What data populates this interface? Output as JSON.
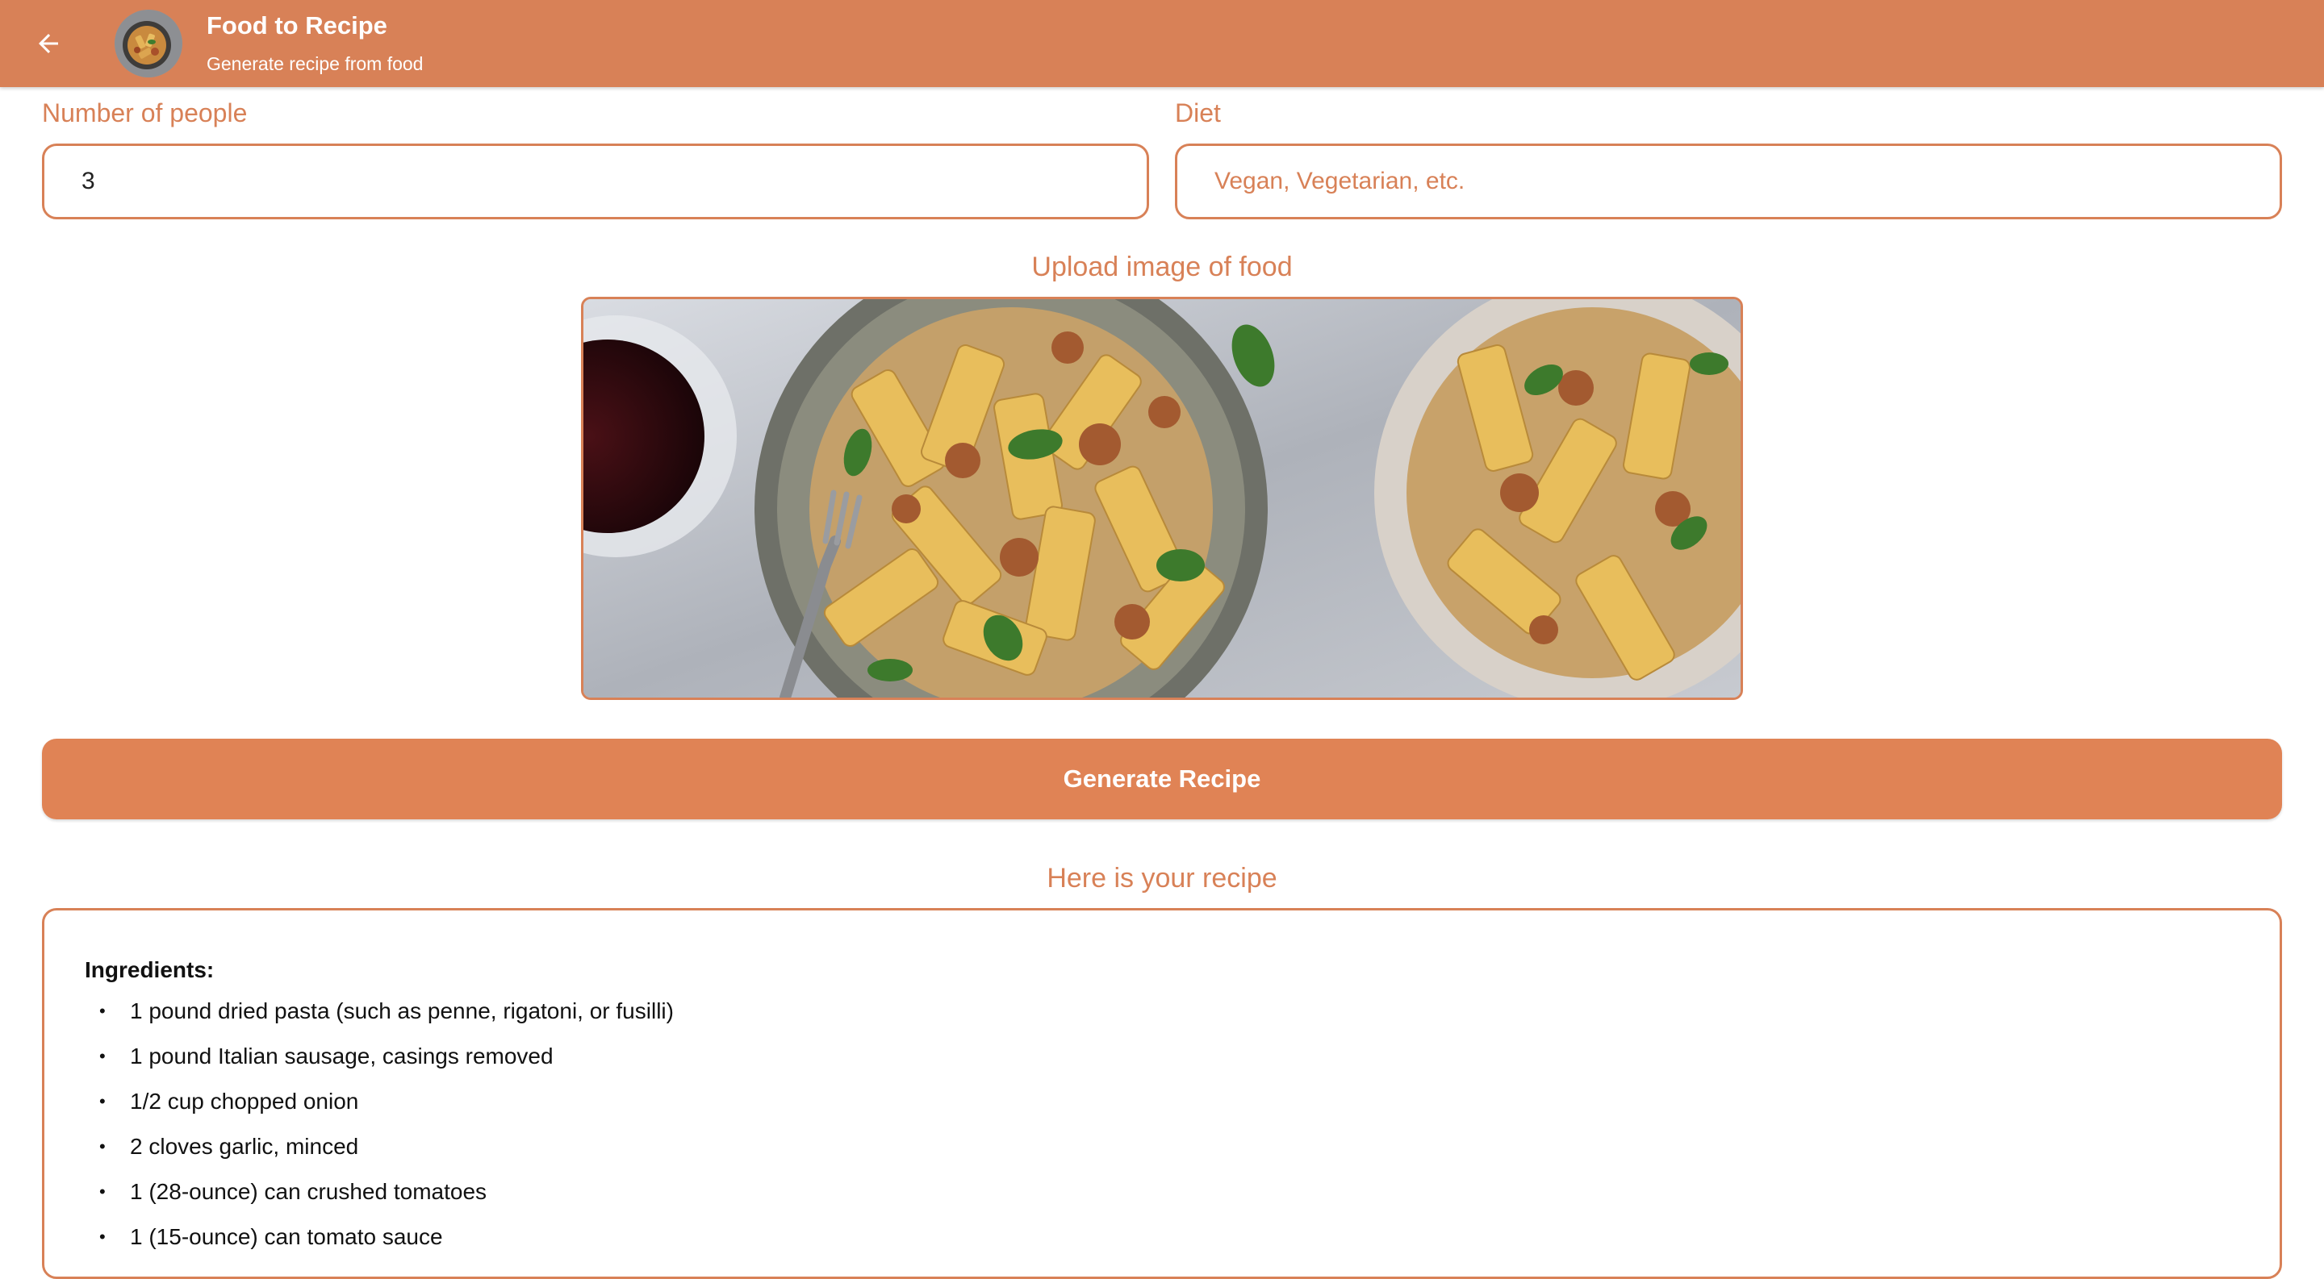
{
  "appbar": {
    "title": "Food to Recipe",
    "subtitle": "Generate recipe from food",
    "back_icon": "arrow-left-icon",
    "color": "#d88157"
  },
  "form": {
    "people_label": "Number of people",
    "people_value": "3",
    "diet_label": "Diet",
    "diet_placeholder": "Vegan, Vegetarian, etc.",
    "diet_value": ""
  },
  "upload": {
    "label": "Upload image of food",
    "image_alt": "Rigatoni pasta with sausage and basil in bowls, fork and glass of red wine"
  },
  "generate_button": "Generate Recipe",
  "recipe": {
    "section_title": "Here is your recipe",
    "heading": "Ingredients:",
    "ingredients": [
      "1 pound dried pasta (such as penne, rigatoni, or fusilli)",
      "1 pound Italian sausage, casings removed",
      "1/2 cup chopped onion",
      "2 cloves garlic, minced",
      "1 (28-ounce) can crushed tomatoes",
      "1 (15-ounce) can tomato sauce"
    ]
  },
  "colors": {
    "accent": "#d88157",
    "button": "#e08355",
    "text": "#111111"
  }
}
